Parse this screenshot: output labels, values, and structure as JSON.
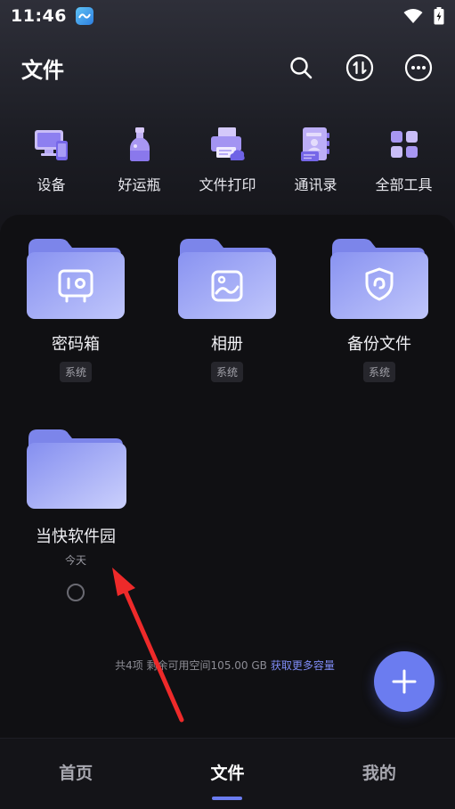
{
  "status_bar": {
    "time": "11:46"
  },
  "header": {
    "title": "文件"
  },
  "tools": [
    {
      "label": "设备",
      "icon": "device-icon"
    },
    {
      "label": "好运瓶",
      "icon": "bottle-icon"
    },
    {
      "label": "文件打印",
      "icon": "printer-icon"
    },
    {
      "label": "通讯录",
      "icon": "contacts-icon"
    },
    {
      "label": "全部工具",
      "icon": "all-tools-icon"
    }
  ],
  "folders": [
    {
      "name": "密码箱",
      "tag": "系统",
      "icon": "safe-icon"
    },
    {
      "name": "相册",
      "tag": "系统",
      "icon": "photo-icon"
    },
    {
      "name": "备份文件",
      "tag": "系统",
      "icon": "shield-icon"
    },
    {
      "name": "当快软件园",
      "date": "今天"
    }
  ],
  "storage": {
    "text": "共4项 剩余可用空间105.00 GB",
    "link": "获取更多容量"
  },
  "nav": [
    {
      "label": "首页"
    },
    {
      "label": "文件"
    },
    {
      "label": "我的"
    }
  ],
  "colors": {
    "accent": "#6b7cf0",
    "folder": "#9aa3f3",
    "annotation": "#ee2a2a"
  }
}
